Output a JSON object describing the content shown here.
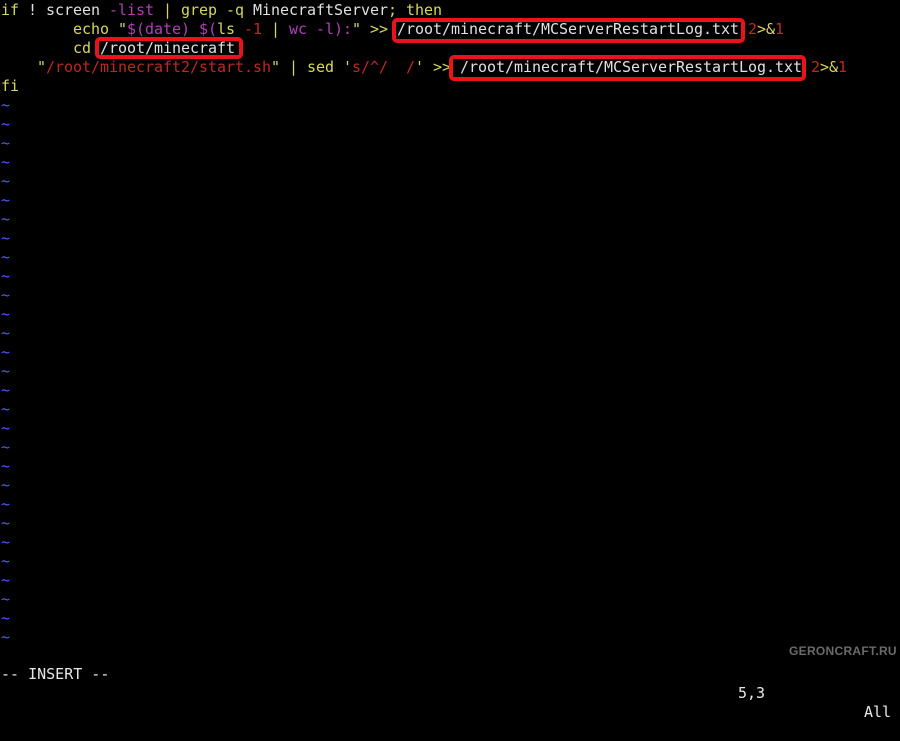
{
  "editor": {
    "lines": [
      [
        {
          "text": "if",
          "color": "yellow"
        },
        {
          "text": " ! ",
          "color": "white"
        },
        {
          "text": "screen",
          "color": "white"
        },
        {
          "text": " ",
          "color": "white"
        },
        {
          "text": "-list",
          "color": "purple"
        },
        {
          "text": " | ",
          "color": "yellow"
        },
        {
          "text": "grep -q",
          "color": "yellow"
        },
        {
          "text": " MinecraftServer",
          "color": "white"
        },
        {
          "text": "; ",
          "color": "yellow"
        },
        {
          "text": "then",
          "color": "yellow"
        }
      ],
      [
        {
          "text": "        ",
          "color": "white"
        },
        {
          "text": "echo",
          "color": "yellow"
        },
        {
          "text": " \"",
          "color": "yellow"
        },
        {
          "text": "$(date)",
          "color": "purple"
        },
        {
          "text": " ",
          "color": "white"
        },
        {
          "text": "$(",
          "color": "purple"
        },
        {
          "text": "ls",
          "color": "yellow"
        },
        {
          "text": " ",
          "color": "white"
        },
        {
          "text": "-1",
          "color": "red"
        },
        {
          "text": " | ",
          "color": "yellow"
        },
        {
          "text": "wc -l):",
          "color": "purple"
        },
        {
          "text": "\" >> ",
          "color": "yellow"
        },
        {
          "text": "/root/minecraft/MCServerRestartLog.txt",
          "color": "white"
        },
        {
          "text": " ",
          "color": "white"
        },
        {
          "text": "2",
          "color": "red"
        },
        {
          "text": ">&",
          "color": "yellow"
        },
        {
          "text": "1",
          "color": "red"
        }
      ],
      [
        {
          "text": "        ",
          "color": "white"
        },
        {
          "text": "cd",
          "color": "yellow"
        },
        {
          "text": " ",
          "color": "white"
        },
        {
          "text": "/root/minecraft",
          "color": "white"
        }
      ],
      [
        {
          "text": "    ",
          "color": "white"
        },
        {
          "text": "\"",
          "color": "yellow"
        },
        {
          "text": "/root/minecraft2/start.sh",
          "color": "red"
        },
        {
          "text": "\"",
          "color": "yellow"
        },
        {
          "text": " | ",
          "color": "yellow"
        },
        {
          "text": "sed",
          "color": "yellow"
        },
        {
          "text": " '",
          "color": "yellow"
        },
        {
          "text": "s/^/  /",
          "color": "red"
        },
        {
          "text": "'",
          "color": "yellow"
        },
        {
          "text": " >> ",
          "color": "yellow"
        },
        {
          "text": "/root/minecraft/MCServerRestartLog.txt",
          "color": "white"
        },
        {
          "text": " ",
          "color": "white"
        },
        {
          "text": "2",
          "color": "red"
        },
        {
          "text": ">&",
          "color": "yellow"
        },
        {
          "text": "1",
          "color": "red"
        }
      ],
      [
        {
          "text": "fi",
          "color": "yellow"
        }
      ]
    ],
    "empty_line_marker": "~",
    "empty_line_count": 29
  },
  "highlights": [
    {
      "label": "/root/minecraft/MCServerRestartLog.txt",
      "line": 2
    },
    {
      "label": "/root/minecraft",
      "line": 3
    },
    {
      "label": "/root/minecraft/MCServerRestartLog.txt",
      "line": 4
    }
  ],
  "statusbar": {
    "mode": "-- INSERT --",
    "cursor_position": "5,3",
    "scroll": "All"
  },
  "watermark": "GERONCRAFT.RU",
  "colors": {
    "yellow": "#d7d75f",
    "white": "#e0e0e0",
    "purple": "#b040b8",
    "red": "#c0281e",
    "tilde": "#4d5cff",
    "highlight_border": "#e8141a"
  }
}
